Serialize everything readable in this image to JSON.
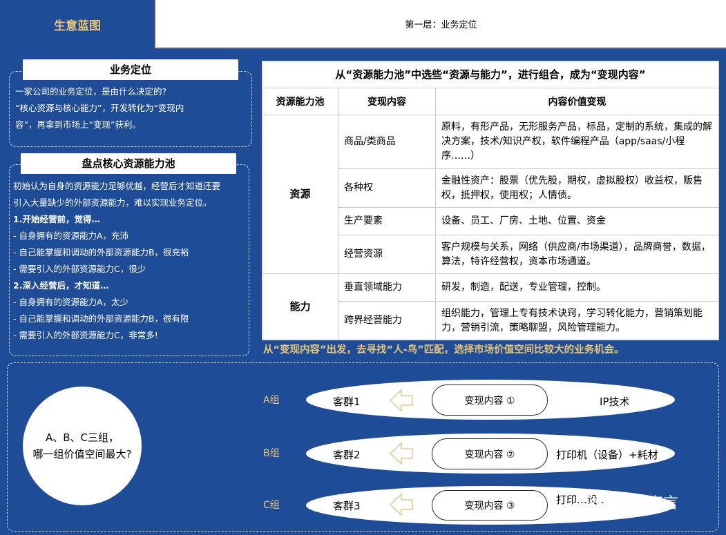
{
  "header": {
    "left_title": "生意蓝图",
    "right_title": "第一层：业务定位"
  },
  "positioning": {
    "label": "业务定位",
    "lines": [
      "一家公司的业务定位，是由什么决定的?",
      "“核心资源与核心能力”，开发转化为“变现内",
      "容”，再拿到市场上“变现”获利。"
    ]
  },
  "inventory": {
    "label": "盘点核心资源能力池",
    "intro_lines": [
      "初始认为自身的资源能力足够优越，经营后才知道还要",
      "引入大量缺少的外部资源能力，难以实现业务定位。"
    ],
    "before_heading": "1.开始经营前，觉得…",
    "before_items": [
      "- 自身拥有的资源能力A，充沛",
      "- 自己能掌握和调动的外部资源能力B，很充裕",
      "- 需要引入的外部资源能力C，很少"
    ],
    "after_heading": "2.深入经营后，才知道…",
    "after_items": [
      "- 自身拥有的资源能力A，太少",
      "- 自己能掌握和调动的外部资源能力B，很有限",
      "- 需要引入的外部资源能力C，非常多!"
    ]
  },
  "table": {
    "title": "从“资源能力池”中选些“资源与能力”，进行组合，成为“变现内容”",
    "headers": [
      "资源能力池",
      "变现内容",
      "内容价值变现"
    ],
    "group_resource": "资源",
    "group_ability": "能力",
    "rows": [
      {
        "item": "商品/类商品",
        "value": "原料，有形产品，无形服务产品，标品，定制的系统，集成的解决方案，技术/知识产权，软件编程产品（app/saas/小程序……）"
      },
      {
        "item": "各种权",
        "value": "金融性资产：股票（优先股，期权，虚拟股权）收益权，贩售权，抵押权，使用权；人情债。"
      },
      {
        "item": "生产要素",
        "value": "设备、员工、厂房、土地、位置、资金"
      },
      {
        "item": "经营资源",
        "value": "客户规模与关系，网络（供应商/市场渠道），品牌商誉，数据，算法，特许经营权，资本市场通道。"
      },
      {
        "item": "垂直领域能力",
        "value": "研发，制造，配送，专业管理，控制。"
      },
      {
        "item": "跨界经营能力",
        "value": "组织能力，管理上专有技术诀窍，学习转化能力，营销策划能力，营销引流，策略聊盟，风险管理能力。"
      }
    ]
  },
  "bottom_caption": "从“变现内容”出发，去寻找“人-鸟”匹配，选择市场价值空间比较大的业务机会。",
  "question": {
    "line1": "A、B、C三组，",
    "line2": "哪一组价值空间最大?"
  },
  "groups": [
    {
      "label": "A组",
      "customer": "客群1",
      "content": "变现内容 ①",
      "offer": "IP技术"
    },
    {
      "label": "B组",
      "customer": "客群2",
      "content": "变现内容 ②",
      "offer": "打印机（设备）+耗材"
    },
    {
      "label": "C组",
      "customer": "客群3",
      "content": "变现内容 ③",
      "offer": "打印…设…行店"
    }
  ],
  "watermark": "践行者宣言"
}
